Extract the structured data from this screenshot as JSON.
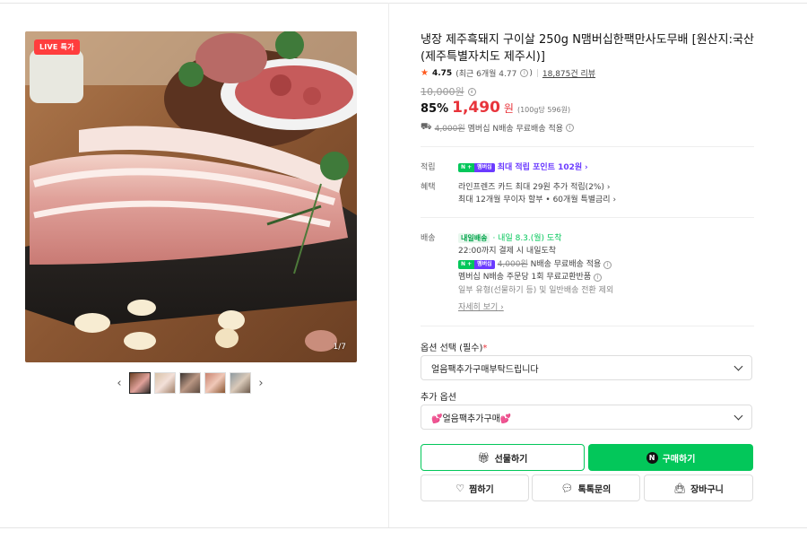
{
  "gallery": {
    "live_badge": "LIVE 특가",
    "pager": "1/7",
    "prev_icon": "chevron-left-icon",
    "next_icon": "chevron-right-icon",
    "thumbnail_count": 5
  },
  "product": {
    "title": "냉장 제주흑돼지 구이살 250g N맴버십한팩만사도무배 [원산지:국산(제주특별자치도 제주시)]",
    "rating": "4.75",
    "rating_recent": "(최근 6개월 4.77",
    "review_count": "18,875건 리뷰",
    "original_price": "10,000원",
    "discount": "85%",
    "price": "1,490",
    "currency": "원",
    "unit_price": "(100g당 596원)",
    "shipping_strike": "4,000원",
    "shipping_text": "멤버십 N배송 무료배송 적용"
  },
  "benefits": {
    "point_label": "적립",
    "point_badge_n": "N +",
    "point_badge_m": "멤버십",
    "point_text": "최대 적립 포인트 102원",
    "benefit_label": "혜택",
    "card_text": "라인프렌즈 카드 최대 29원 추가 적립(2%)",
    "installment_text": "최대 12개월 무이자 할부 • 60개월 특별금리"
  },
  "delivery": {
    "label": "배송",
    "tomorrow_badge": "내일배송",
    "arrival": "· 내일 8.3.(월) 도착",
    "deadline": "22:00까지 결제 시 내일도착",
    "member_strike": "4,000원",
    "member_text": "N배송 무료배송 적용",
    "return_text": "멤버십 N배송 주문당 1회 무료교환반품",
    "exception": "일부 유형(선물하기 등) 및 일반배송 전환 제외",
    "more_link": "자세히 보기"
  },
  "options": {
    "required_label": "옵션 선택 (필수)",
    "required_mark": "*",
    "required_value": "얼음팩추가구매부탁드립니다",
    "extra_label": "추가 옵션",
    "extra_value": "💕얼음팩추가구매💕"
  },
  "actions": {
    "gift": "선물하기",
    "buy": "구매하기",
    "buy_n": "N",
    "wish": "찜하기",
    "talk": "톡톡문의",
    "cart": "장바구니"
  },
  "colors": {
    "accent_green": "#03c75a",
    "price_red": "#e8343b",
    "membership_purple": "#6b3bff"
  }
}
